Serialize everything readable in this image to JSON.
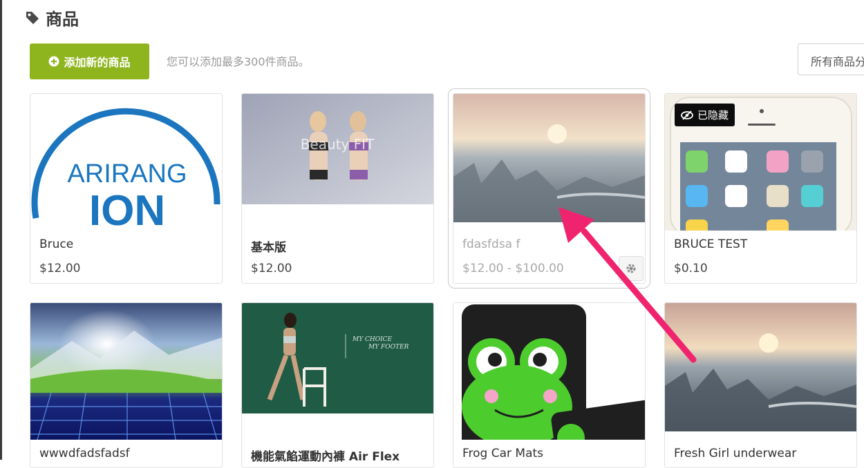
{
  "header": {
    "title": "商品",
    "title_icon": "tag-icon"
  },
  "toolbar": {
    "add_label": "添加新的商品",
    "hint": "您可以添加最多300件商品。",
    "filter_label": "所有商品分类"
  },
  "products": [
    {
      "name": "Bruce",
      "price": "$12.00"
    },
    {
      "name": "基本版",
      "price": "$12.00",
      "image_text": "Beauty FIT"
    },
    {
      "name": "fdasfdsa f",
      "price": "$12.00 - $100.00"
    },
    {
      "name": "BRUCE TEST",
      "price": "$0.10",
      "badge": "已隐藏"
    },
    {
      "name": "wwwdfadsfadsf"
    },
    {
      "name": "機能氣餡運動內褲 Air Flex",
      "image_text": [
        "MY CHOICE",
        "MY FOOTER"
      ]
    },
    {
      "name": "Frog Car Mats"
    },
    {
      "name": "Fresh Girl underwear"
    }
  ],
  "logo": {
    "line1": "ARIRANG",
    "line2": "ION"
  },
  "colors": {
    "accent": "#8fb51e",
    "arrow": "#f0246e",
    "badge": "#0d0d0d"
  }
}
